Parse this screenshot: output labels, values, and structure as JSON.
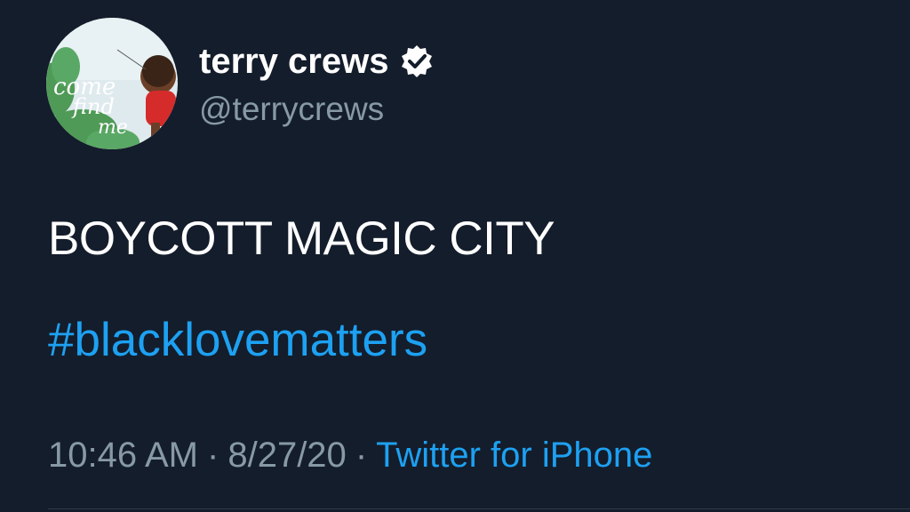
{
  "author": {
    "display_name": "terry crews",
    "handle": "@terrycrews",
    "verified": true,
    "verified_icon": "verified-badge-icon",
    "avatar_text_lines": [
      "come",
      "find",
      "me"
    ]
  },
  "tweet": {
    "text": "BOYCOTT MAGIC CITY",
    "hashtag": "#blacklovematters"
  },
  "meta": {
    "time": "10:46 AM",
    "separator": "·",
    "date": "8/27/20",
    "source": "Twitter for iPhone"
  },
  "colors": {
    "background": "#141d2b",
    "text": "#ffffff",
    "secondary_text": "#8899a6",
    "link": "#1da1f2"
  }
}
